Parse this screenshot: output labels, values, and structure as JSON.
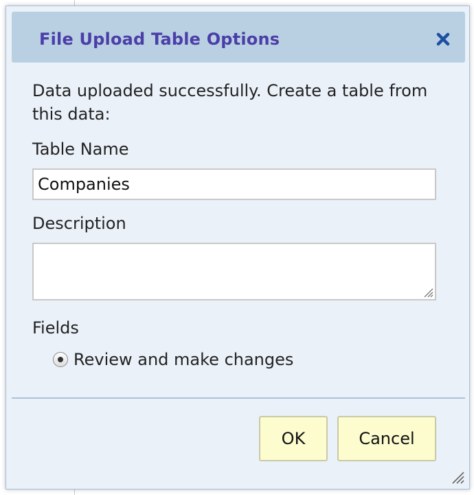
{
  "dialog": {
    "title": "File Upload Table Options",
    "close_icon": "close-icon",
    "message": "Data uploaded successfully. Create a table from this data:",
    "table_name": {
      "label": "Table Name",
      "value": "Companies"
    },
    "description": {
      "label": "Description",
      "value": ""
    },
    "fields": {
      "label": "Fields",
      "option_label": "Review and make changes",
      "selected": true
    },
    "buttons": {
      "ok_label": "OK",
      "cancel_label": "Cancel"
    }
  },
  "colors": {
    "title_text": "#4b3ea8",
    "titlebar_bg": "#b9d0e2",
    "dialog_bg": "#eaf1f9",
    "button_bg": "#fcfccf",
    "close_icon": "#1d4fa3"
  }
}
